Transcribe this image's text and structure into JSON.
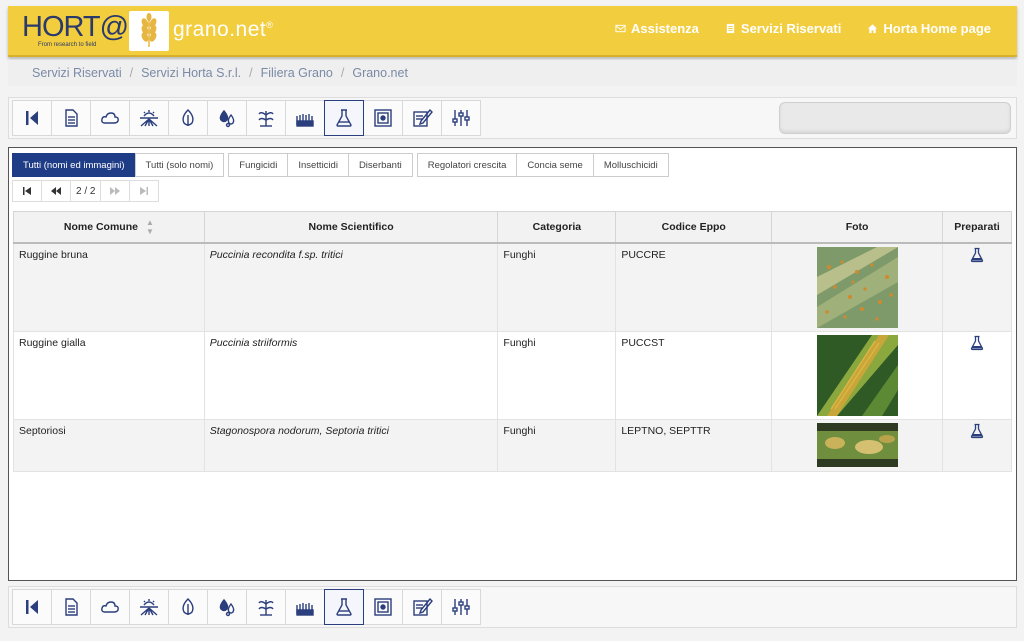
{
  "brand": {
    "logo_text": "HORT@",
    "logo_tagline": "From research to field",
    "site_name": "grano.net",
    "site_reg": "®",
    "accent": "#f2cd3d",
    "primary": "#1f3c86"
  },
  "topnav": [
    {
      "label": "Assistenza",
      "icon": "envelope-icon"
    },
    {
      "label": "Servizi Riservati",
      "icon": "document-icon"
    },
    {
      "label": "Horta Home page",
      "icon": "home-icon"
    }
  ],
  "breadcrumb": [
    "Servizi Riservati",
    "Servizi Horta S.r.l.",
    "Filiera Grano",
    "Grano.net"
  ],
  "toolbar_icons": [
    "back-first-icon",
    "document-icon",
    "cloud-icon",
    "sun-field-icon",
    "leaf-drop-icon",
    "water-drops-icon",
    "weed-plant-icon",
    "insects-icon",
    "flask-icon",
    "map-icon",
    "notepad-icon",
    "sliders-icon"
  ],
  "filters": [
    "Tutti (nomi ed immagini)",
    "Tutti (solo nomi)",
    "Fungicidi",
    "Insetticidi",
    "Diserbanti",
    "Regolatori crescita",
    "Concia seme",
    "Molluschicidi"
  ],
  "pager": {
    "info": "2 / 2"
  },
  "table": {
    "headers": [
      "Nome Comune",
      "Nome Scientifico",
      "Categoria",
      "Codice Eppo",
      "Foto",
      "Preparati"
    ],
    "rows": [
      {
        "nome": "Ruggine bruna",
        "scientifico": "Puccinia recondita f.sp. tritici",
        "categoria": "Funghi",
        "eppo": "PUCCRE"
      },
      {
        "nome": "Ruggine gialla",
        "scientifico": "Puccinia striiformis",
        "categoria": "Funghi",
        "eppo": "PUCCST"
      },
      {
        "nome": "Septoriosi",
        "scientifico": "Stagonospora nodorum, Septoria tritici",
        "categoria": "Funghi",
        "eppo": "LEPTNO, SEPTTR"
      }
    ]
  }
}
